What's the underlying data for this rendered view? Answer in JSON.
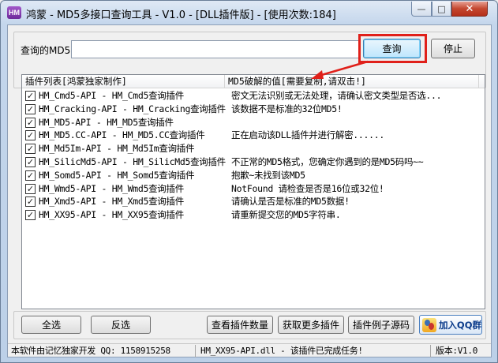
{
  "window": {
    "title": "鸿蒙 - MD5多接口查询工具 - V1.0 - [DLL插件版] - [使用次数:184]",
    "icon_text": "HM",
    "controls": {
      "minimize": "—",
      "maximize": "□",
      "close": "✕"
    }
  },
  "query": {
    "label": "查询的MD5:",
    "value": "",
    "query_button": "查询",
    "stop_button": "停止"
  },
  "list": {
    "columns": [
      "插件列表[鸿蒙独家制作]",
      "MD5破解的值[需要复制,请双击!]"
    ],
    "rows": [
      {
        "checked": true,
        "plugin": "HM_Cmd5-API - HM_Cmd5查询插件",
        "result": "密文无法识别或无法处理，请确认密文类型是否选..."
      },
      {
        "checked": true,
        "plugin": "HM_Cracking-API - HM_Cracking查询插件",
        "result": "该数据不是标准的32位MD5!"
      },
      {
        "checked": true,
        "plugin": "HM_MD5-API - HM_MD5查询插件",
        "result": ""
      },
      {
        "checked": true,
        "plugin": "HM_MD5.CC-API - HM_MD5.CC查询插件",
        "result": "正在启动该DLL插件并进行解密......"
      },
      {
        "checked": true,
        "plugin": "HM_Md5Im-API - HM_Md5Im查询插件",
        "result": ""
      },
      {
        "checked": true,
        "plugin": "HM_SilicMd5-API - HM_SilicMd5查询插件",
        "result": "不正常的MD5格式，您确定你遇到的是MD5码吗~~"
      },
      {
        "checked": true,
        "plugin": "HM_Somd5-API - HM_Somd5查询插件",
        "result": "抱歉~未找到该MD5"
      },
      {
        "checked": true,
        "plugin": "HM_Wmd5-API - HM_Wmd5查询插件",
        "result": "NotFound 请检查是否是16位或32位!"
      },
      {
        "checked": true,
        "plugin": "HM_Xmd5-API - HM_Xmd5查询插件",
        "result": "请确认是否是标准的MD5数据!"
      },
      {
        "checked": true,
        "plugin": "HM_XX95-API - HM_XX95查询插件",
        "result": "请重新提交您的MD5字符串."
      }
    ]
  },
  "buttons": {
    "select_all": "全选",
    "invert": "反选",
    "view_count": "查看插件数量",
    "get_more": "获取更多插件",
    "example_source": "插件例子源码",
    "join_qq": "加入QQ群"
  },
  "status": {
    "left": "本软件由记忆独家开发 QQ: 1158915258",
    "middle": "HM_XX95-API.dll - 该插件已完成任务!",
    "right": "版本:V1.0"
  }
}
